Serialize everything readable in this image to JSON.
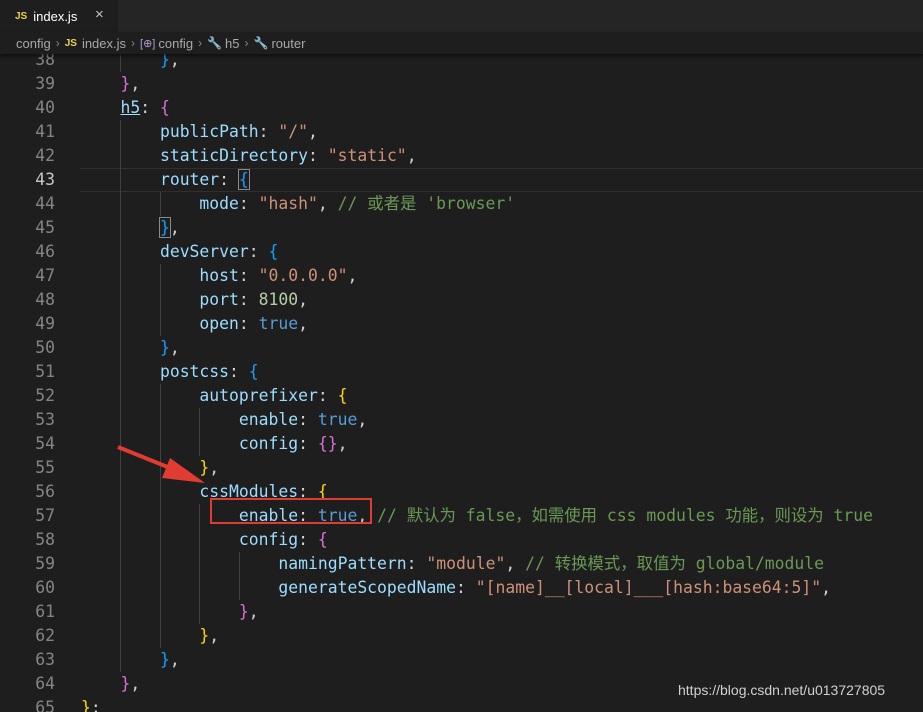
{
  "tab": {
    "badge": "JS",
    "name": "index.js",
    "close": "×"
  },
  "breadcrumb": {
    "items": [
      "config",
      "index.js",
      "config",
      "h5",
      "router"
    ],
    "js_badge": "JS",
    "object_icon": "[⊕]",
    "sep": "›"
  },
  "lines": [
    {
      "n": "38",
      "t": "        },"
    },
    {
      "n": "39",
      "t": "    },"
    },
    {
      "n": "40",
      "t": "    h5: {"
    },
    {
      "n": "41",
      "t": "        publicPath: \"/\","
    },
    {
      "n": "42",
      "t": "        staticDirectory: \"static\","
    },
    {
      "n": "43",
      "t": "        router: {"
    },
    {
      "n": "44",
      "t": "            mode: \"hash\", // 或者是 'browser'"
    },
    {
      "n": "45",
      "t": "        },"
    },
    {
      "n": "46",
      "t": "        devServer: {"
    },
    {
      "n": "47",
      "t": "            host: \"0.0.0.0\","
    },
    {
      "n": "48",
      "t": "            port: 8100,"
    },
    {
      "n": "49",
      "t": "            open: true,"
    },
    {
      "n": "50",
      "t": "        },"
    },
    {
      "n": "51",
      "t": "        postcss: {"
    },
    {
      "n": "52",
      "t": "            autoprefixer: {"
    },
    {
      "n": "53",
      "t": "                enable: true,"
    },
    {
      "n": "54",
      "t": "                config: {},"
    },
    {
      "n": "55",
      "t": "            },"
    },
    {
      "n": "56",
      "t": "            cssModules: {"
    },
    {
      "n": "57",
      "t": "                enable: true, // 默认为 false，如需使用 css modules 功能，则设为 true"
    },
    {
      "n": "58",
      "t": "                config: {"
    },
    {
      "n": "59",
      "t": "                    namingPattern: \"module\", // 转换模式，取值为 global/module"
    },
    {
      "n": "60",
      "t": "                    generateScopedName: \"[name]__[local]___[hash:base64:5]\","
    },
    {
      "n": "61",
      "t": "                },"
    },
    {
      "n": "62",
      "t": "            },"
    },
    {
      "n": "63",
      "t": "        },"
    },
    {
      "n": "64",
      "t": "    },"
    },
    {
      "n": "65",
      "t": "};"
    }
  ],
  "current_line": "43",
  "watermark": "https://blog.csdn.net/u013727805",
  "colors": {
    "background": "#1e1e1e",
    "property": "#9cdcfe",
    "string": "#ce9178",
    "number": "#b5cea8",
    "keyword": "#569cd6",
    "comment": "#6a9955",
    "annotation": "#e03c31"
  }
}
